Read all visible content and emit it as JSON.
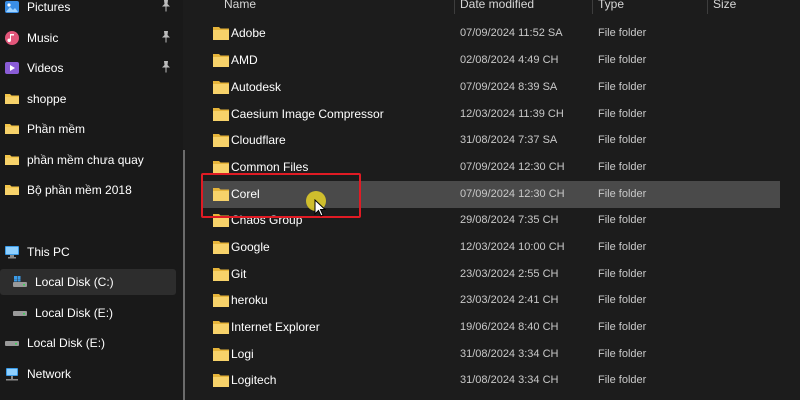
{
  "sidebar": {
    "items": [
      {
        "label": "Pictures",
        "icon": "pictures-icon",
        "pinned": true
      },
      {
        "label": "Music",
        "icon": "music-icon",
        "pinned": true
      },
      {
        "label": "Videos",
        "icon": "videos-icon",
        "pinned": true
      },
      {
        "label": "shoppe",
        "icon": "folder-icon",
        "pinned": false
      },
      {
        "label": "Phần mềm",
        "icon": "folder-icon",
        "pinned": false
      },
      {
        "label": "phần mềm chưa quay",
        "icon": "folder-icon",
        "pinned": false
      },
      {
        "label": "Bộ phần mềm 2018",
        "icon": "folder-icon",
        "pinned": false
      },
      {
        "label": "This PC",
        "icon": "computer-icon",
        "pinned": false
      },
      {
        "label": "Local Disk (C:)",
        "icon": "windows-drive-icon",
        "pinned": false,
        "selected": true
      },
      {
        "label": "Local Disk (E:)",
        "icon": "drive-icon",
        "pinned": false
      },
      {
        "label": "Local Disk (E:)",
        "icon": "drive-icon",
        "pinned": false
      },
      {
        "label": "Network",
        "icon": "network-icon",
        "pinned": false
      }
    ]
  },
  "file_list": {
    "columns": {
      "name": "Name",
      "date": "Date modified",
      "type": "Type",
      "size": "Size"
    },
    "rows": [
      {
        "name": "Adobe",
        "date": "07/09/2024 11:52 SA",
        "type": "File folder"
      },
      {
        "name": "AMD",
        "date": "02/08/2024 4:49 CH",
        "type": "File folder"
      },
      {
        "name": "Autodesk",
        "date": "07/09/2024 8:39 SA",
        "type": "File folder"
      },
      {
        "name": "Caesium Image Compressor",
        "date": "12/03/2024 11:39 CH",
        "type": "File folder"
      },
      {
        "name": "Cloudflare",
        "date": "31/08/2024 7:37 SA",
        "type": "File folder"
      },
      {
        "name": "Common Files",
        "date": "07/09/2024 12:30 CH",
        "type": "File folder"
      },
      {
        "name": "Corel",
        "date": "07/09/2024 12:30 CH",
        "type": "File folder",
        "selected": true
      },
      {
        "name": "Chaos Group",
        "date": "29/08/2024 7:35 CH",
        "type": "File folder"
      },
      {
        "name": "Google",
        "date": "12/03/2024 10:00 CH",
        "type": "File folder"
      },
      {
        "name": "Git",
        "date": "23/03/2024 2:55 CH",
        "type": "File folder"
      },
      {
        "name": "heroku",
        "date": "23/03/2024 2:41 CH",
        "type": "File folder"
      },
      {
        "name": "Internet Explorer",
        "date": "19/06/2024 8:40 CH",
        "type": "File folder"
      },
      {
        "name": "Logi",
        "date": "31/08/2024 3:34 CH",
        "type": "File folder"
      },
      {
        "name": "Logitech",
        "date": "31/08/2024 3:34 CH",
        "type": "File folder"
      }
    ]
  },
  "colors": {
    "background": "#1c1c1c",
    "folder": "#f3c54a",
    "selection": "#4a4a4a",
    "highlight_box": "#e01b24",
    "cursor_dot": "#e6d228"
  }
}
